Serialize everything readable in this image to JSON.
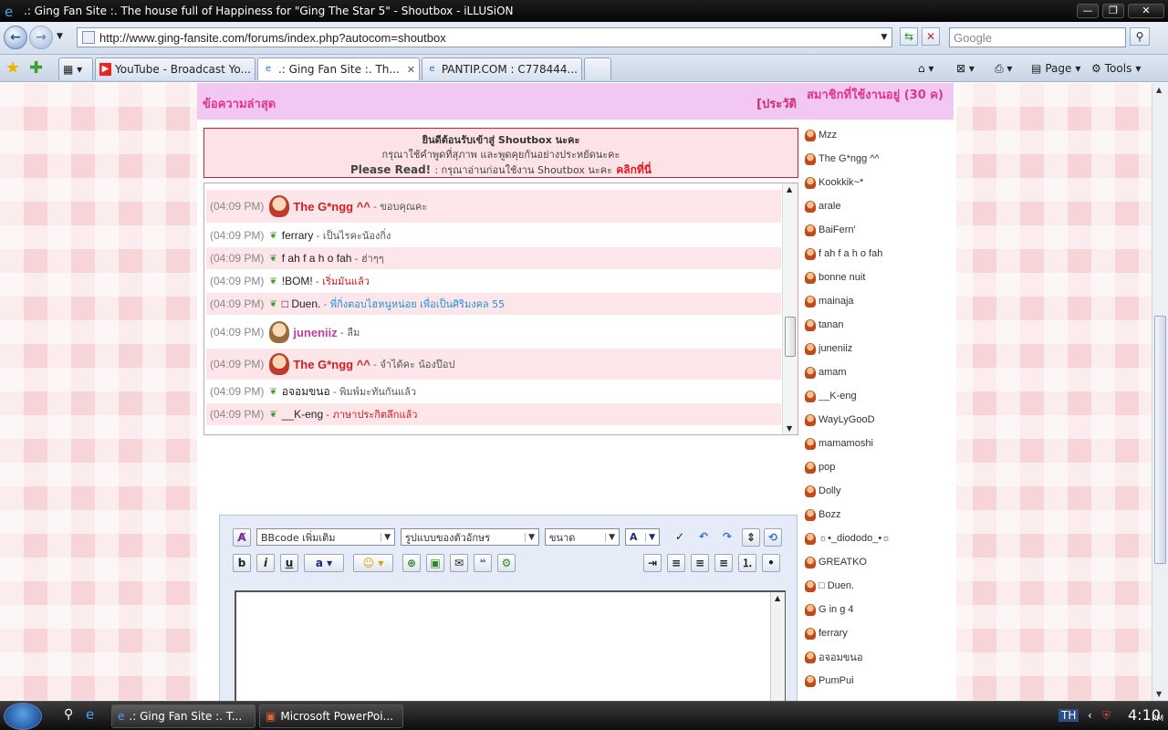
{
  "window": {
    "title": ".: Ging Fan Site :. The house full of Happiness for \"Ging The Star 5\" - Shoutbox - iLLUSiON",
    "controls": [
      "—",
      "❐",
      "✕"
    ]
  },
  "address": {
    "url": "http://www.ging-fansite.com/forums/index.php?autocom=shoutbox",
    "search_placeholder": "Google"
  },
  "tabs": [
    {
      "label": "YouTube - Broadcast Yo...",
      "icon": "youtube-icon"
    },
    {
      "label": ".: Ging Fan Site :. Th...",
      "icon": "ie-page-icon"
    },
    {
      "label": "PANTIP.COM : C778444...",
      "icon": "ie-page-icon"
    }
  ],
  "toolbar": {
    "page_label": "Page",
    "tools_label": "Tools"
  },
  "shoutbox": {
    "heading": "ข้อความล่าสุด",
    "history_link": "[ประวัติ",
    "notice_line1": "ยินดีต้อนรับเข้าสู่ Shoutbox นะคะ",
    "notice_line2": "กรุณาใช้คำพูดที่สุภาพ และพูดคุยกันอย่างประหยัดนะคะ",
    "notice_line3_bold": "Please Read!",
    "notice_line3_text": ": กรุณาอ่านก่อนใช้งาน Shoutbox นะคะ",
    "notice_line3_link": "คลิกที่นี่",
    "messages": [
      {
        "time": "(04:09 PM)",
        "name": "The G*ngg ^^",
        "text": "- ขอบคุณคะ",
        "style": "big"
      },
      {
        "time": "(04:09 PM)",
        "name": "ferrary",
        "text": "- เป็นไรคะน้องกิ่ง",
        "style": "normal"
      },
      {
        "time": "(04:09 PM)",
        "name": "f ah f a h o fah",
        "text": "- ฮ่าๆๆ",
        "style": "normal"
      },
      {
        "time": "(04:09 PM)",
        "name": "!BOM!",
        "text": "- เริ่มมันแล้ว",
        "style": "normal",
        "tone": "red"
      },
      {
        "time": "(04:09 PM)",
        "name": "□ Duen.",
        "text": "- พี่กิ่งตอบไฮหนูหน่อย เพื่อเป็นศิริมงคล 55",
        "style": "normal",
        "tone": "blue"
      },
      {
        "time": "(04:09 PM)",
        "name": "juneniiz",
        "text": "- ลืม",
        "style": "pink"
      },
      {
        "time": "(04:09 PM)",
        "name": "The G*ngg ^^",
        "text": "- จำได้คะ น้องป๊อป",
        "style": "big"
      },
      {
        "time": "(04:09 PM)",
        "name": "อจอมขนอ",
        "text": "- พิมพ์มะทันกันแล้ว",
        "style": "normal"
      },
      {
        "time": "(04:09 PM)",
        "name": "__K-eng",
        "text": "- ภาษาประกิตลึกแล้ว",
        "style": "normal",
        "tone": "red"
      }
    ]
  },
  "editor": {
    "bbcode_select": "BBcode เพิ่มเติม",
    "font_select": "รูปแบบของตัวอักษร",
    "size_select": "ขนาด",
    "bold": "b",
    "italic": "i",
    "underline": "u"
  },
  "members": {
    "heading": "สมาชิกที่ใช้งานอยู่ (30 ค)",
    "list": [
      "Mzz",
      "The G*ngg ^^",
      "Kookkik~*",
      "arale",
      "BaiFern'",
      "f ah f a h o fah",
      "bonne nuit",
      "mainaja",
      "tanan",
      "juneniiz",
      "amam",
      "__K-eng",
      "WayLyGooD",
      "mamamoshi",
      "pop",
      "Dolly",
      "Bozz",
      "☼•_diododo_•☼",
      "GREATKO",
      "□ Duen.",
      "G in g 4",
      "ferrary",
      "อจอมขนอ",
      "PumPui"
    ]
  },
  "taskbar": {
    "items": [
      ".: Ging Fan Site :. T...",
      "Microsoft PowerPoi..."
    ],
    "language": "TH",
    "clock": "4:10",
    "clock_suffix": "PM"
  },
  "colors": {
    "accent_pink": "#e0338a",
    "header_bg": "#f2c8f2",
    "notice_border": "#c81f3c"
  }
}
